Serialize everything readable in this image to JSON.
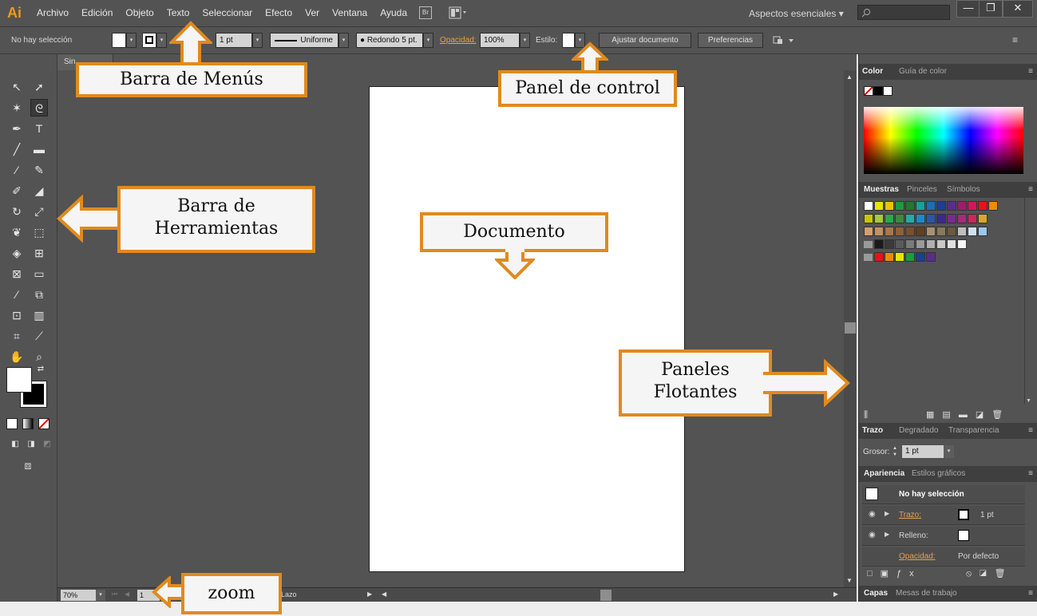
{
  "app": {
    "logo": "Ai"
  },
  "menubar": {
    "items": [
      "Archivo",
      "Edición",
      "Objeto",
      "Texto",
      "Seleccionar",
      "Efecto",
      "Ver",
      "Ventana",
      "Ayuda"
    ],
    "bridge_label": "Br",
    "workspace": "Aspectos esenciales",
    "window_buttons": [
      "—",
      "❐",
      "✕"
    ]
  },
  "control": {
    "no_selection": "No hay selección",
    "stroke_weight": "1 pt",
    "profile": "Uniforme",
    "brush": "Redondo 5 pt.",
    "opacity_label": "Opacidad:",
    "opacity_value": "100%",
    "style_label": "Estilo:",
    "adjust_doc": "Ajustar documento",
    "preferences": "Preferencias"
  },
  "document": {
    "tab_label": "Sin"
  },
  "status": {
    "zoom": "70%",
    "page": "1",
    "tool": "Lazo"
  },
  "panels": {
    "color_tabs": [
      "Color",
      "Guía de color"
    ],
    "swatch_tabs": [
      "Muestras",
      "Pinceles",
      "Símbolos"
    ],
    "stroke_tabs": [
      "Trazo",
      "Degradado",
      "Transparencia"
    ],
    "stroke_weight_label": "Grosor:",
    "stroke_weight_value": "1 pt",
    "appearance_tabs": [
      "Apariencia",
      "Estilos gráficos"
    ],
    "appearance_title": "No hay selección",
    "appearance_rows": [
      {
        "label": "Trazo:",
        "value": "1 pt"
      },
      {
        "label": "Relleno:",
        "value": ""
      },
      {
        "label": "Opacidad:",
        "value": "Por defecto"
      }
    ],
    "layers_tabs": [
      "Capas",
      "Mesas de trabajo"
    ]
  },
  "swatches": {
    "row1": [
      "#e6e600",
      "#e8c500",
      "#1a9e3a",
      "#1f7a2c",
      "#18a19a",
      "#1a6fb3",
      "#1c3f94",
      "#5b2c8e",
      "#9b1e6b",
      "#d8145a",
      "#e8121a",
      "#f08a00"
    ],
    "row2": [
      "#c8c800",
      "#a8c83c",
      "#2aa84a",
      "#3c8a3c",
      "#2aa8a8",
      "#1a8ac8",
      "#2a56a8",
      "#3a2a8e",
      "#7a2a8e",
      "#a82a7a",
      "#c82a5a",
      "#d8a828"
    ],
    "row3": [
      "#d0a070",
      "#c89060",
      "#a87848",
      "#906038",
      "#785030",
      "#604020",
      "#a89070",
      "#8a7858",
      "#6a5a40",
      "#bfbfbf",
      "#d0e0f0",
      "#9ec8e8"
    ],
    "row4": [
      "#1a1a1a",
      "#3a3a3a",
      "#5a5a5a",
      "#7a7a7a",
      "#9a9a9a",
      "#b0b0b0",
      "#c8c8c8",
      "#e0e0e0",
      "#f4f4f4"
    ],
    "row5": [
      "#e8121a",
      "#f08a00",
      "#e6e600",
      "#1a9e3a",
      "#1c3f94",
      "#5b2c8e"
    ]
  },
  "annotations": {
    "menus": "Barra de Menús",
    "control": "Panel de control",
    "tools_line1": "Barra de",
    "tools_line2": "Herramientas",
    "document": "Documento",
    "panels_line1": "Paneles",
    "panels_line2": "Flotantes",
    "zoom": "zoom"
  },
  "colors": {
    "accent": "#e08a1e",
    "ui_bg": "#535353",
    "artboard": "#ffffff"
  }
}
